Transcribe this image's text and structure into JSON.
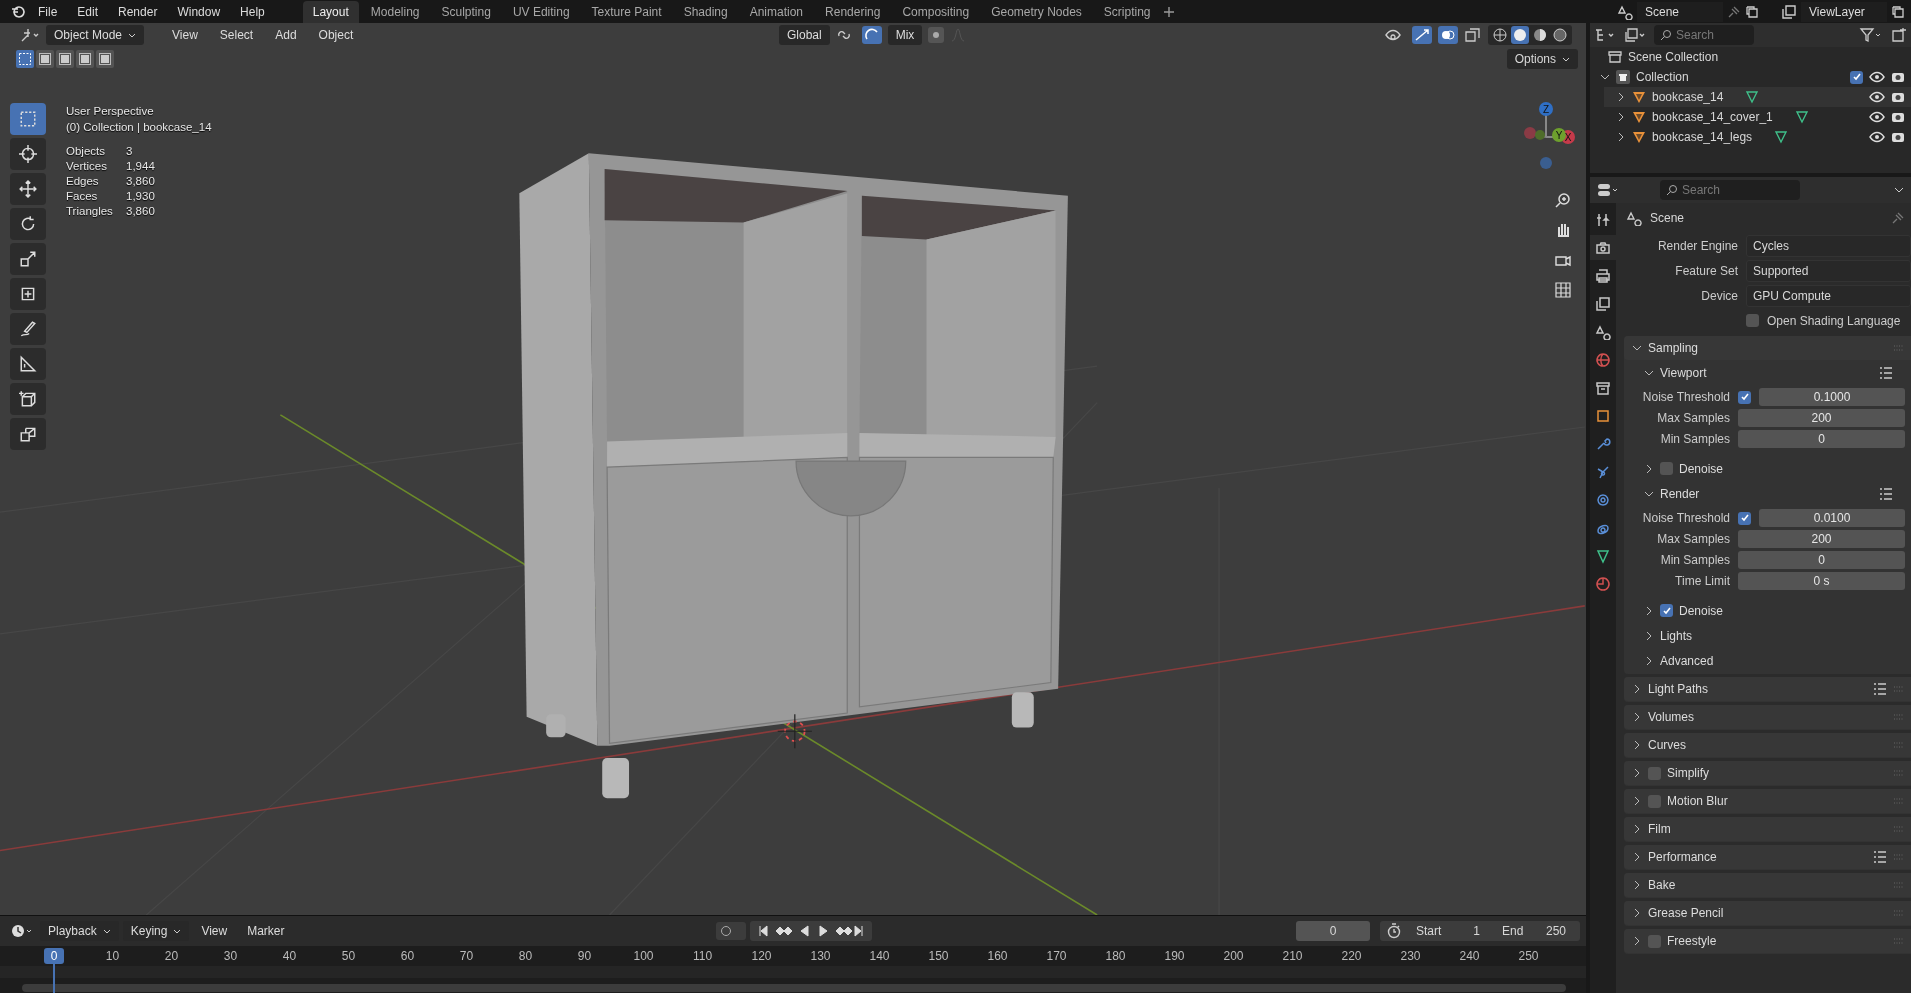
{
  "topbar": {
    "menus": [
      "File",
      "Edit",
      "Render",
      "Window",
      "Help"
    ],
    "workspaces": [
      {
        "label": "Layout",
        "selected": true
      },
      {
        "label": "Modeling",
        "selected": false
      },
      {
        "label": "Sculpting",
        "selected": false
      },
      {
        "label": "UV Editing",
        "selected": false
      },
      {
        "label": "Texture Paint",
        "selected": false
      },
      {
        "label": "Shading",
        "selected": false
      },
      {
        "label": "Animation",
        "selected": false
      },
      {
        "label": "Rendering",
        "selected": false
      },
      {
        "label": "Compositing",
        "selected": false
      },
      {
        "label": "Geometry Nodes",
        "selected": false
      },
      {
        "label": "Scripting",
        "selected": false
      }
    ],
    "scene": "Scene",
    "view_layer": "ViewLayer"
  },
  "viewport_header": {
    "mode": "Object Mode",
    "menus": [
      "View",
      "Select",
      "Add",
      "Object"
    ],
    "orientation": "Global",
    "snapping": "Mix",
    "options": "Options"
  },
  "select_modes": [
    {
      "selected": true
    },
    {
      "selected": false
    },
    {
      "selected": false
    },
    {
      "selected": false
    },
    {
      "selected": false
    }
  ],
  "overlay": {
    "view": "User Perspective",
    "collection": "(0) Collection | bookcase_14",
    "stats": [
      {
        "label": "Objects",
        "value": "3"
      },
      {
        "label": "Vertices",
        "value": "1,944"
      },
      {
        "label": "Edges",
        "value": "3,860"
      },
      {
        "label": "Faces",
        "value": "1,930"
      },
      {
        "label": "Triangles",
        "value": "3,860"
      }
    ]
  },
  "gizmo_axes": [
    "Z",
    "Y",
    "X"
  ],
  "tools": [
    {
      "kind": "select",
      "selected": true
    },
    {
      "kind": "cursor",
      "selected": false
    },
    {
      "kind": "move",
      "selected": false
    },
    {
      "kind": "rotate",
      "selected": false
    },
    {
      "kind": "scale",
      "selected": false
    },
    {
      "kind": "transform",
      "selected": false
    },
    {
      "kind": "annotate",
      "selected": false
    },
    {
      "kind": "measure",
      "selected": false
    },
    {
      "kind": "add_cube",
      "selected": false
    },
    {
      "kind": "extrude",
      "selected": false
    }
  ],
  "outliner": {
    "search_placeholder": "Search",
    "root": "Scene Collection",
    "collection": {
      "name": "Collection",
      "expanded": true,
      "checked": true,
      "children": [
        {
          "name": "bookcase_14",
          "selected": true
        },
        {
          "name": "bookcase_14_cover_1",
          "selected": false
        },
        {
          "name": "bookcase_14_legs",
          "selected": false
        }
      ]
    }
  },
  "properties": {
    "search_placeholder": "Search",
    "context": "Scene",
    "tabs": [
      {
        "kind": "tool",
        "selected": false
      },
      {
        "kind": "render",
        "selected": true
      },
      {
        "kind": "output",
        "selected": false
      },
      {
        "kind": "view_layer",
        "selected": false
      },
      {
        "kind": "scene",
        "selected": false
      },
      {
        "kind": "world",
        "selected": false
      },
      {
        "kind": "collection",
        "selected": false
      },
      {
        "kind": "object",
        "selected": false
      },
      {
        "kind": "modifiers",
        "selected": false
      },
      {
        "kind": "particles",
        "selected": false
      },
      {
        "kind": "physics",
        "selected": false
      },
      {
        "kind": "constraints",
        "selected": false
      },
      {
        "kind": "data",
        "selected": false
      },
      {
        "kind": "material",
        "selected": false
      }
    ],
    "fields": [
      {
        "label": "Render Engine",
        "value": "Cycles"
      },
      {
        "label": "Feature Set",
        "value": "Supported"
      },
      {
        "label": "Device",
        "value": "GPU Compute"
      }
    ],
    "osl": {
      "label": "Open Shading Language",
      "checked": false
    },
    "panels": [
      {
        "title": "Sampling",
        "expanded": true,
        "presets": false,
        "subpanels": [
          {
            "title": "Viewport",
            "expanded": true,
            "presets": true,
            "rows": [
              {
                "label": "Noise Threshold",
                "value": "0.1000",
                "checked": true
              },
              {
                "label": "Max Samples",
                "value": "200"
              },
              {
                "label": "Min Samples",
                "value": "0"
              }
            ]
          },
          {
            "title": "Denoise",
            "expanded": false,
            "presets": false,
            "checked": false
          },
          {
            "title": "Render",
            "expanded": true,
            "presets": true,
            "rows": [
              {
                "label": "Noise Threshold",
                "value": "0.0100",
                "checked": true
              },
              {
                "label": "Max Samples",
                "value": "200"
              },
              {
                "label": "Min Samples",
                "value": "0"
              },
              {
                "label": "Time Limit",
                "value": "0 s"
              }
            ]
          },
          {
            "title": "Denoise",
            "expanded": false,
            "presets": false,
            "checked": true
          },
          {
            "title": "Lights",
            "expanded": false,
            "presets": false
          },
          {
            "title": "Advanced",
            "expanded": false,
            "presets": false
          }
        ]
      },
      {
        "title": "Light Paths",
        "expanded": false,
        "presets": true
      },
      {
        "title": "Volumes",
        "expanded": false,
        "presets": false
      },
      {
        "title": "Curves",
        "expanded": false,
        "presets": false
      },
      {
        "title": "Simplify",
        "expanded": false,
        "presets": false,
        "checked": false
      },
      {
        "title": "Motion Blur",
        "expanded": false,
        "presets": false,
        "checked": false
      },
      {
        "title": "Film",
        "expanded": false,
        "presets": false
      },
      {
        "title": "Performance",
        "expanded": false,
        "presets": true
      },
      {
        "title": "Bake",
        "expanded": false,
        "presets": false
      },
      {
        "title": "Grease Pencil",
        "expanded": false,
        "presets": false
      },
      {
        "title": "Freestyle",
        "expanded": false,
        "presets": false,
        "checked": false
      }
    ]
  },
  "timeline": {
    "menus": [
      "Playback",
      "Keying",
      "View",
      "Marker"
    ],
    "frame": "0",
    "start_label": "Start",
    "start": "1",
    "end_label": "End",
    "end": "250",
    "playhead": "0",
    "ruler": [
      "10",
      "20",
      "30",
      "40",
      "50",
      "60",
      "70",
      "80",
      "90",
      "100",
      "110",
      "120",
      "130",
      "140",
      "150",
      "160",
      "170",
      "180",
      "190",
      "200",
      "210",
      "220",
      "230",
      "240",
      "250"
    ]
  }
}
